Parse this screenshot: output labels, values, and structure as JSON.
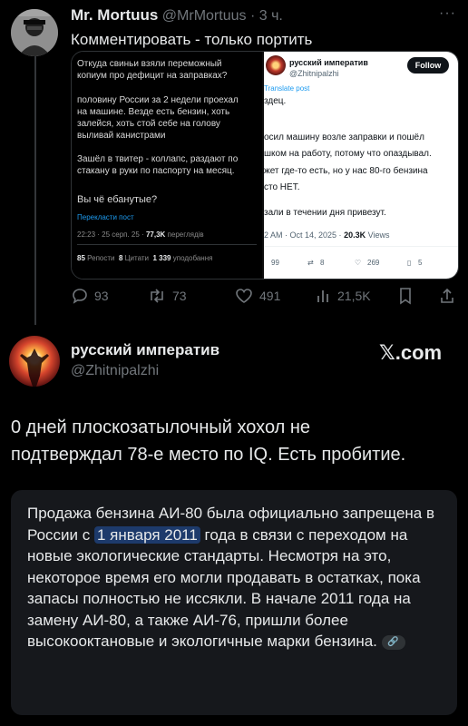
{
  "tweet": {
    "author_name": "Mr. Mortuus",
    "author_handle": "@MrMortuus",
    "time": "· 3 ч.",
    "text": "Комментировать - только портить",
    "more_icon": "ellipsis-icon"
  },
  "embedded_left": {
    "lines": [
      "Откуда свиньи взяли переможный",
      "копиум про дефицит на заправках?",
      "половину России за 2 недели проехал",
      "на машине. Везде есть бензин, хоть",
      "залейся, хоть стой себе на голову",
      "выливай канистрами",
      "Зашёл в твитер - коллапс, раздают по",
      "стакану в руки по паспорту на месяц.",
      "Вы чё ебанутые?"
    ],
    "translate": "Перекласти пост",
    "meta_time": "22:23 · 25 серп. 25 ·",
    "meta_views": "77,3K",
    "meta_views_label": "переглядів",
    "reposts": "85",
    "reposts_label": "Репости",
    "quotes": "8",
    "quotes_label": "Цитати",
    "likes": "1 339",
    "likes_label": "уподобання"
  },
  "embedded_right": {
    "name": "русский императив",
    "handle": "@Zhitnipalzhi",
    "follow": "Follow",
    "translate": "Translate post",
    "lines": [
      "здец.",
      "осил машину возле заправки и пошёл",
      "шком на работу, потому что опаздывал.",
      "жет где-то есть, но у нас 80-го бензина",
      "сто НЕТ.",
      "зали в течении дня привезут."
    ],
    "meta_time": "2 AM · Oct 14, 2025 ·",
    "meta_views": "20.3K",
    "meta_views_label": "Views",
    "replies": "99",
    "reposts": "8",
    "likes": "269",
    "bookmarks": "5"
  },
  "actions": {
    "replies": "93",
    "reposts": "73",
    "likes": "491",
    "views": "21,5K"
  },
  "reply": {
    "author_name": "русский императив",
    "author_handle": "@Zhitnipalzhi",
    "brand": "𝕏.com",
    "text_line1": "0 дней плоскозатылочный хохол не",
    "text_line2": "подтверждал 78-е место по IQ. Есть пробитие."
  },
  "card": {
    "text_before": "Продажа бензина АИ-80 была официально запрещена в России с ",
    "highlight": "1 января 2011",
    "text_after": " года в связи с переходом на новые экологические стандарты. Несмотря на это, некоторое время его могли продавать в остатках, пока запасы полностью не иссякли. В начале 2011 года на замену АИ-80, а также АИ-76, пришли более высокооктановые и экологичные марки бензина.",
    "link_icon": "link-icon"
  },
  "colors": {
    "background": "#000000",
    "text": "#e7e9ea",
    "muted": "#71767b",
    "highlight": "#1d3a6b",
    "link_blue": "#1d9bf0"
  }
}
